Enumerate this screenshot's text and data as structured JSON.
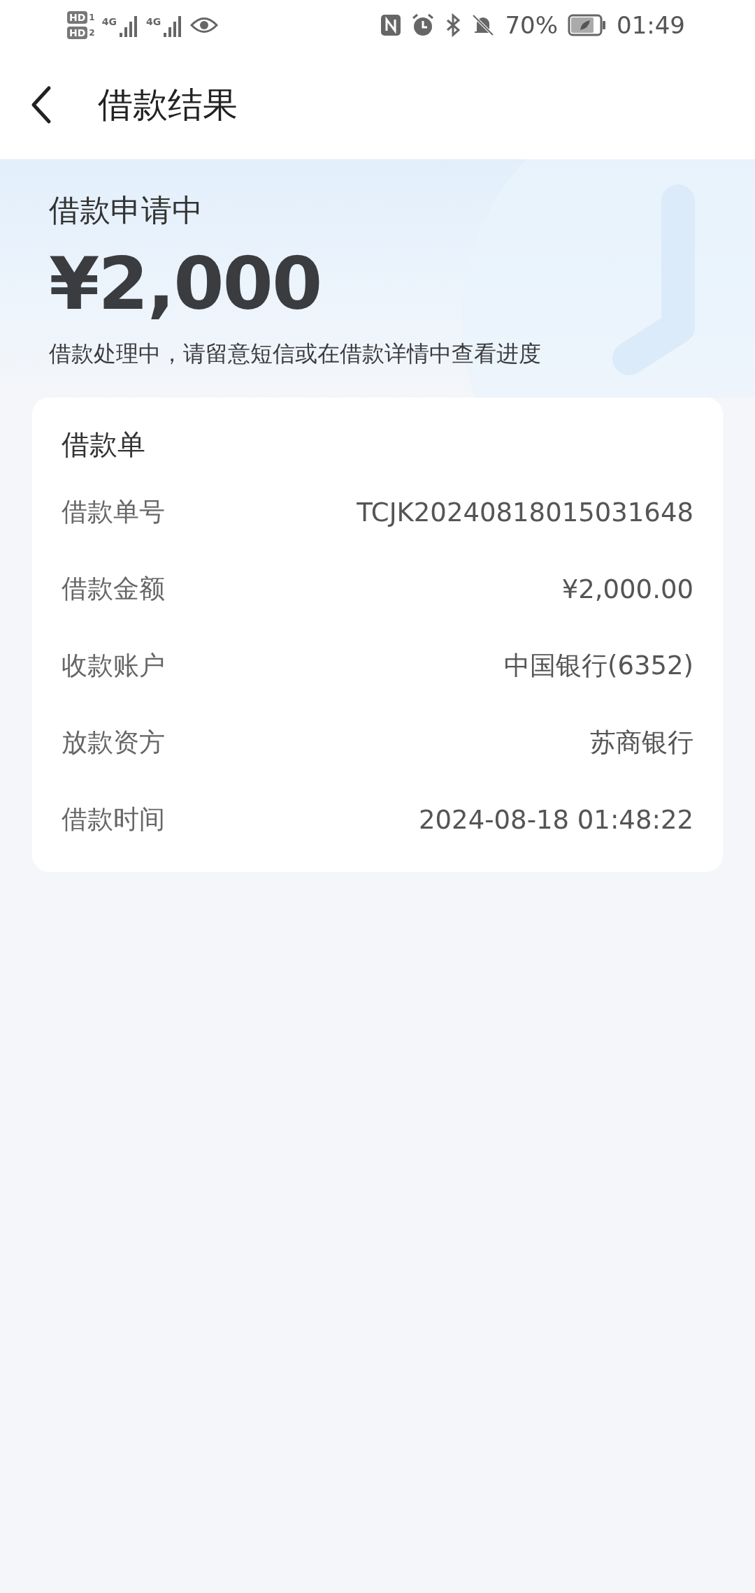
{
  "status_bar": {
    "sims": [
      {
        "hd": "HD",
        "slot": "1",
        "network": "4G"
      },
      {
        "hd": "HD",
        "slot": "2",
        "network": "4G"
      }
    ],
    "battery": "70%",
    "time": "01:49"
  },
  "header": {
    "title": "借款结果"
  },
  "hero": {
    "status": "借款申请中",
    "amount": "¥2,000",
    "message": "借款处理中，请留意短信或在借款详情中查看进度"
  },
  "card": {
    "title": "借款单",
    "rows": [
      {
        "label": "借款单号",
        "value": "TCJK20240818015031648"
      },
      {
        "label": "借款金额",
        "value": "¥2,000.00"
      },
      {
        "label": "收款账户",
        "value": "中国银行(6352)"
      },
      {
        "label": "放款资方",
        "value": "苏商银行"
      },
      {
        "label": "借款时间",
        "value": "2024-08-18 01:48:22"
      }
    ]
  }
}
